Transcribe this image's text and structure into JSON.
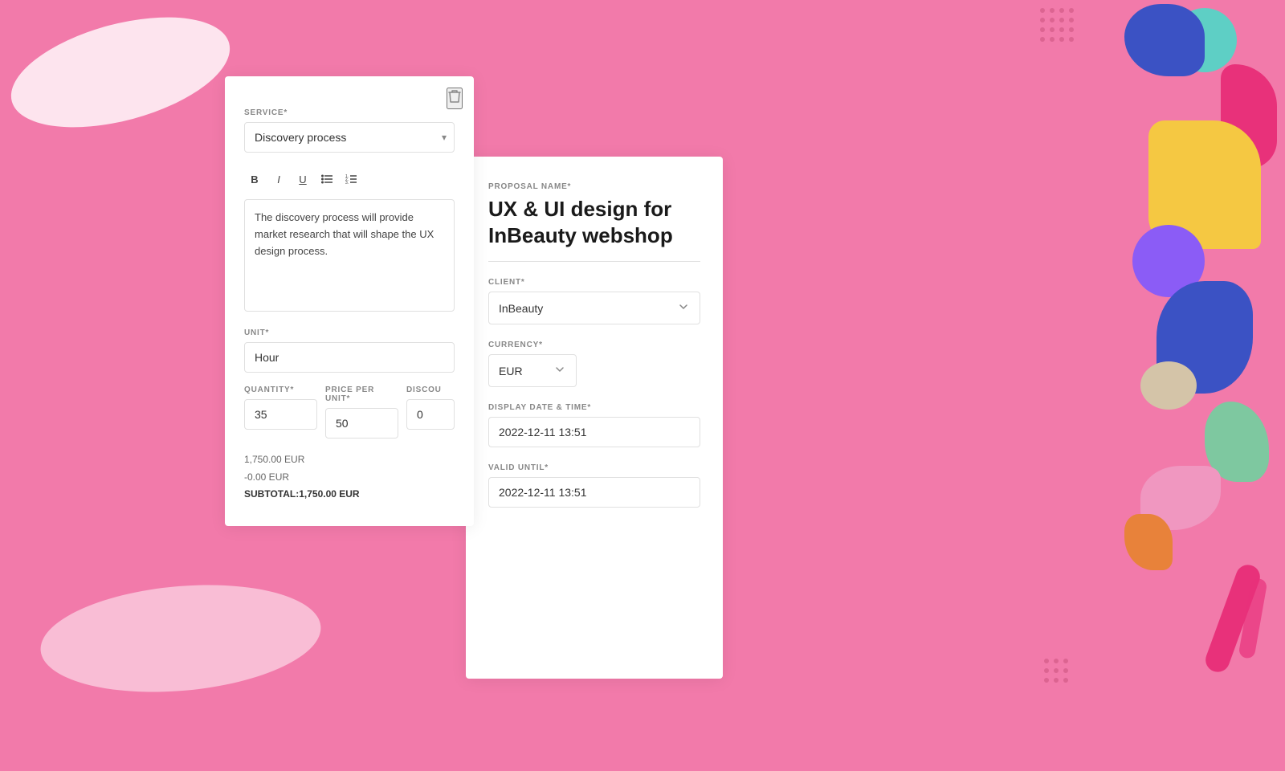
{
  "background": {
    "color": "#f27aaa"
  },
  "left_card": {
    "delete_icon": "🗑",
    "service_label": "SERVICE*",
    "service_value": "Discovery process",
    "editor": {
      "bold_label": "B",
      "italic_label": "I",
      "underline_label": "U",
      "list_unordered": "☰",
      "list_ordered": "☰"
    },
    "description": "The discovery process will provide market research that will shape the UX design process.",
    "unit_label": "UNIT*",
    "unit_value": "Hour",
    "quantity_label": "QUANTITY*",
    "quantity_value": "35",
    "price_label": "PRICE PER UNIT*",
    "price_value": "50",
    "discount_label": "DISCOU",
    "discount_value": "0",
    "total_line1": "1,750.00 EUR",
    "total_line2": "-0.00 EUR",
    "subtotal_label": "SUBTOTAL:",
    "subtotal_value": "1,750.00 EUR"
  },
  "right_card": {
    "proposal_name_label": "PROPOSAL NAME*",
    "proposal_name": "UX & UI design for InBeauty webshop",
    "client_label": "CLIENT*",
    "client_value": "InBeauty",
    "currency_label": "CURRENCY*",
    "currency_value": "EUR",
    "display_date_label": "DISPLAY DATE & TIME*",
    "display_date_value": "2022-12-11 13:51",
    "valid_until_label": "VALID UNTIL*",
    "valid_until_value": "2022-12-11 13:51"
  }
}
